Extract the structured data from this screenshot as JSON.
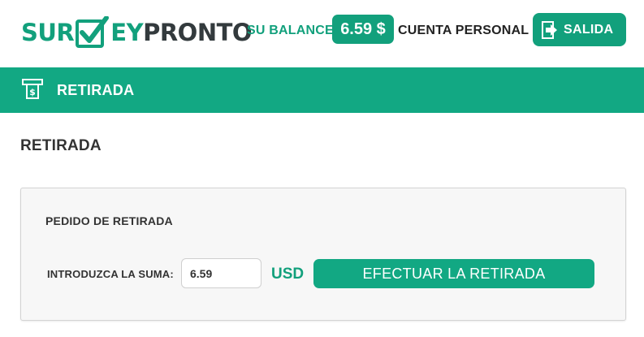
{
  "header": {
    "logo": {
      "part1": "SUR",
      "part2": "EY",
      "part3": "PRONTO"
    },
    "balance_label": "SU BALANCE",
    "balance_value": "6.59 $",
    "account_link": "CUENTA PERSONAL",
    "logout_label": "SALIDA"
  },
  "section": {
    "title": "RETIRADA",
    "icon": "cash-withdraw-icon"
  },
  "page": {
    "title": "RETIRADA"
  },
  "withdraw_form": {
    "title": "PEDIDO DE RETIRADA",
    "amount_label": "INTRODUZCA LA SUMA:",
    "amount_value": "6.59",
    "currency": "USD",
    "submit_label": "EFECTUAR LA RETIRADA"
  },
  "colors": {
    "brand_green": "#12a07c",
    "bar_green": "#12a883",
    "dark_text": "#333333"
  }
}
